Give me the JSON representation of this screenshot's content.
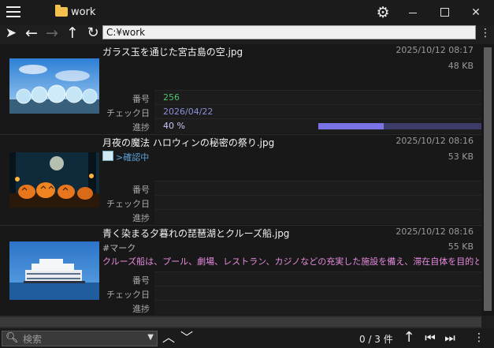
{
  "window": {
    "title": "work"
  },
  "toolbar": {
    "path": "C:¥work"
  },
  "files": [
    {
      "name": "ガラス玉を通じた宮古島の空.jpg",
      "date": "2025/10/12 08:17",
      "size": "48 KB",
      "fields": {
        "number_label": "番号",
        "number": "256",
        "check_label": "チェック日",
        "check": "2026/04/22",
        "progress_label": "進捗",
        "progress": "40 %"
      },
      "progress_value": 0.4
    },
    {
      "name": "月夜の魔法 ハロウィンの秘密の祭り.jpg",
      "date": "2025/10/12 08:16",
      "size": "53 KB",
      "status": ">確認中",
      "fields": {
        "number_label": "番号",
        "check_label": "チェック日",
        "progress_label": "進捗"
      }
    },
    {
      "name": "青く染まる夕暮れの琵琶湖とクルーズ船.jpg",
      "date": "2025/10/12 08:16",
      "size": "55 KB",
      "tag": "#マーク",
      "description": "クルーズ船は、プール、劇場、レストラン、カジノなどの充実した施設を備え、滞在自体を目的とした「動くホテル」の」",
      "fields": {
        "number_label": "番号",
        "check_label": "チェック日",
        "progress_label": "進捗"
      }
    }
  ],
  "search": {
    "placeholder": "検索"
  },
  "footer": {
    "count": "0 / 3 件"
  },
  "colors": {
    "number": "#4ec26a",
    "check": "#8a8fd8",
    "progress": "#7a73e6",
    "description": "#e88be0",
    "status": "#5aa0d8"
  }
}
